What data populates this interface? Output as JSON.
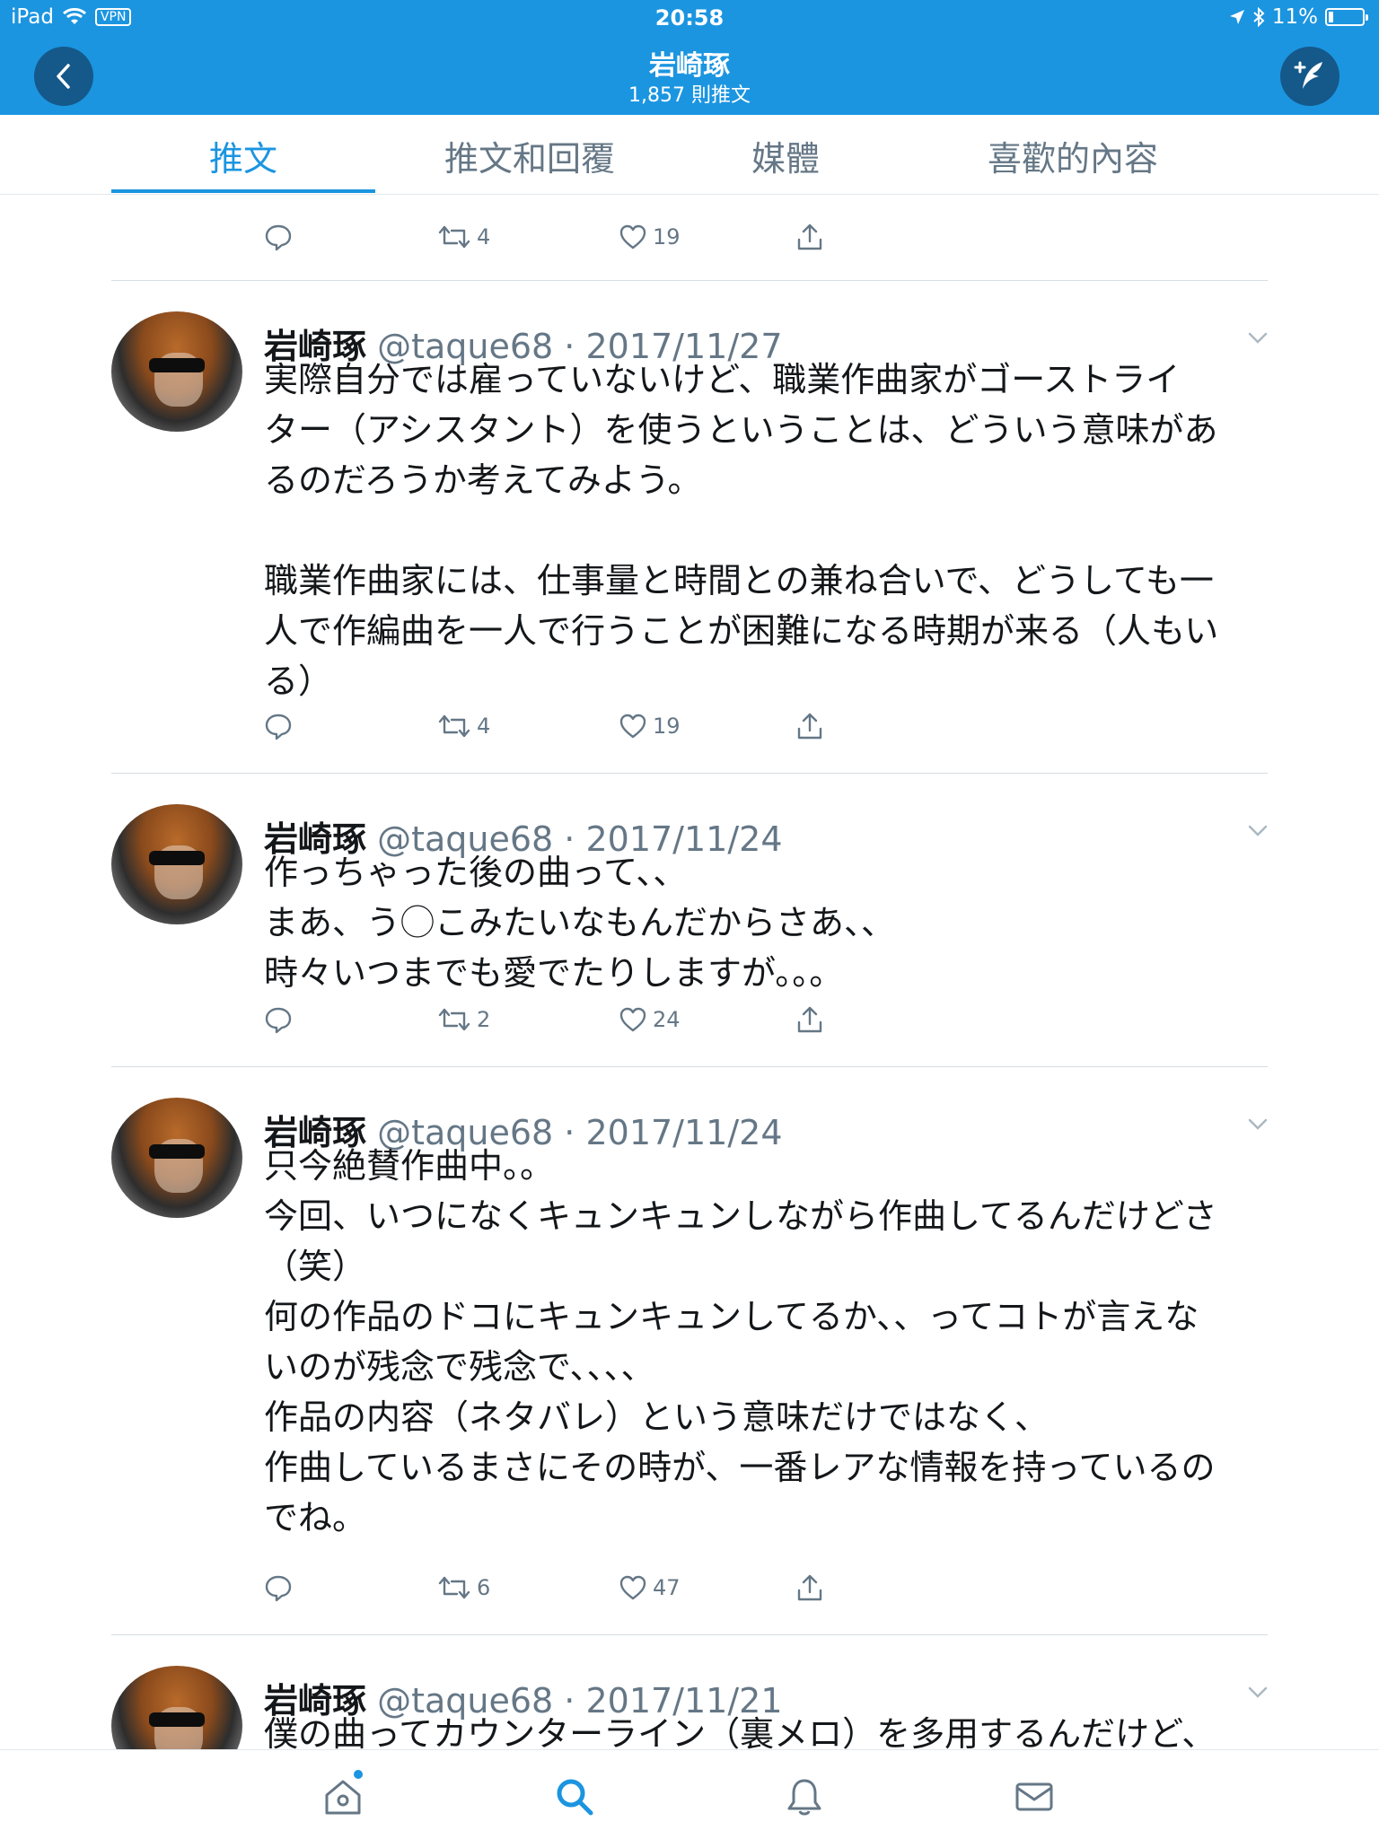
{
  "status_bar": {
    "device": "iPad",
    "vpn": "VPN",
    "time": "20:58",
    "battery": "11%"
  },
  "nav": {
    "title": "岩崎琢",
    "subtitle": "1,857 則推文"
  },
  "tabs": [
    {
      "label": "推文",
      "active": true
    },
    {
      "label": "推文和回覆",
      "active": false
    },
    {
      "label": "媒體",
      "active": false
    },
    {
      "label": "喜歡的內容",
      "active": false
    }
  ],
  "top_partial_tweet": {
    "retweets": "4",
    "likes": "19"
  },
  "tweets": [
    {
      "name": "岩崎琢",
      "meta": "@taque68 · 2017/11/27",
      "text": "実際自分では雇っていないけど、職業作曲家がゴーストライ\nター（アシスタント）を使うということは、どういう意味があ\nるのだろうか考えてみよう。\n\n職業作曲家には、仕事量と時間との兼ね合いで、どうしても一\n人で作編曲を一人で行うことが困難になる時期が来る（人もい\nる）",
      "retweets": "4",
      "likes": "19"
    },
    {
      "name": "岩崎琢",
      "meta": "@taque68 · 2017/11/24",
      "text": "作っちゃった後の曲って、、\nまあ、う◯こみたいなもんだからさあ、、\n時々いつまでも愛でたりしますが。。。",
      "retweets": "2",
      "likes": "24"
    },
    {
      "name": "岩崎琢",
      "meta": "@taque68 · 2017/11/24",
      "text": "只今絶賛作曲中。。\n今回、いつになくキュンキュンしながら作曲してるんだけどさ\n（笑）\n何の作品のドコにキュンキュンしてるか、、ってコトが言えな\nいのが残念で残念で、、、、\n作品の内容（ネタバレ）という意味だけではなく、\n作曲しているまさにその時が、一番レアな情報を持っているの\nでね。",
      "retweets": "6",
      "likes": "47"
    },
    {
      "name": "岩崎琢",
      "meta": "@taque68 · 2017/11/21",
      "text": "僕の曲ってカウンターライン（裏メロ）を多用するんだけど、\nそれはメロディ、という一つの（男かな）結論に対して幾つか"
    }
  ],
  "icons": {
    "back": "chevron-left-icon",
    "compose": "compose-tweet-icon",
    "reply": "reply-icon",
    "retweet": "retweet-icon",
    "like": "heart-icon",
    "share": "share-icon",
    "caret": "chevron-down-icon",
    "home": "home-icon",
    "search": "search-icon",
    "notifications": "bell-icon",
    "messages": "mail-icon"
  },
  "colors": {
    "brand": "#1b95e0",
    "nav_button": "#15588a",
    "muted": "#657786",
    "text": "#14171a"
  }
}
